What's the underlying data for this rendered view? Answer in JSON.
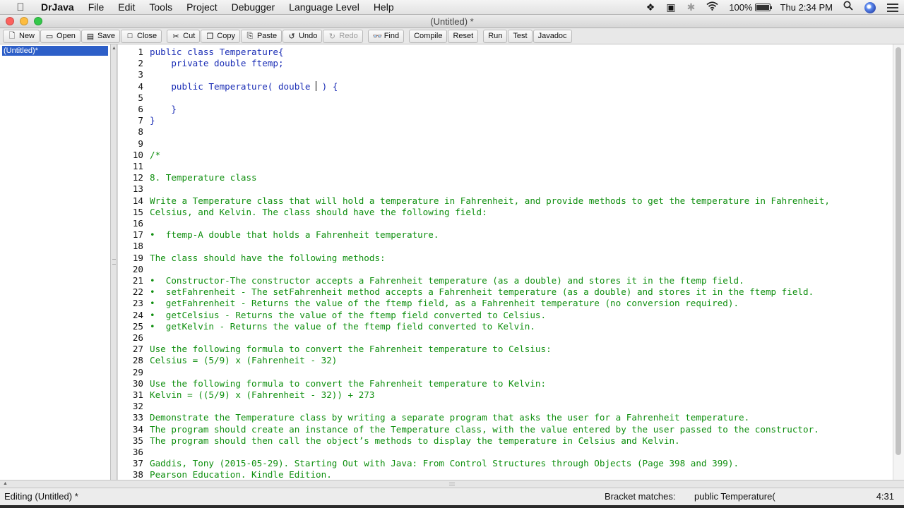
{
  "menubar": {
    "app_name": "DrJava",
    "menus": [
      "File",
      "Edit",
      "Tools",
      "Project",
      "Debugger",
      "Language Level",
      "Help"
    ],
    "battery_text": "100%",
    "clock": "Thu 2:34 PM"
  },
  "window": {
    "title": "(Untitled) *"
  },
  "toolbar": {
    "new": "New",
    "open": "Open",
    "save": "Save",
    "close": "Close",
    "cut": "Cut",
    "copy": "Copy",
    "paste": "Paste",
    "undo": "Undo",
    "redo": "Redo",
    "find": "Find",
    "compile": "Compile",
    "reset": "Reset",
    "run": "Run",
    "test": "Test",
    "javadoc": "Javadoc"
  },
  "documents": {
    "items": [
      "(Untitled)*"
    ]
  },
  "editor": {
    "lines": [
      {
        "n": "1",
        "text": "public class Temperature{",
        "kind": "code"
      },
      {
        "n": "2",
        "text": "    private double ftemp;",
        "kind": "code"
      },
      {
        "n": "3",
        "text": "",
        "kind": "code"
      },
      {
        "n": "4",
        "text": "    public Temperature( double ",
        "kind": "code",
        "caret_after": " ) {"
      },
      {
        "n": "5",
        "text": "",
        "kind": "code"
      },
      {
        "n": "6",
        "text": "    }",
        "kind": "code"
      },
      {
        "n": "7",
        "text": "}",
        "kind": "code"
      },
      {
        "n": "8",
        "text": "",
        "kind": "code"
      },
      {
        "n": "9",
        "text": "",
        "kind": "code"
      },
      {
        "n": "10",
        "text": "/*",
        "kind": "cm"
      },
      {
        "n": "11",
        "text": "",
        "kind": "cm"
      },
      {
        "n": "12",
        "text": "8. Temperature class",
        "kind": "cm"
      },
      {
        "n": "13",
        "text": "",
        "kind": "cm"
      },
      {
        "n": "14",
        "text": "Write a Temperature class that will hold a temperature in Fahrenheit, and provide methods to get the temperature in Fahrenheit,",
        "kind": "cm"
      },
      {
        "n": "15",
        "text": "Celsius, and Kelvin. The class should have the following field:",
        "kind": "cm"
      },
      {
        "n": "16",
        "text": "",
        "kind": "cm"
      },
      {
        "n": "17",
        "text": "•  ftemp-A double that holds a Fahrenheit temperature.",
        "kind": "cm"
      },
      {
        "n": "18",
        "text": "",
        "kind": "cm"
      },
      {
        "n": "19",
        "text": "The class should have the following methods:",
        "kind": "cm"
      },
      {
        "n": "20",
        "text": "",
        "kind": "cm"
      },
      {
        "n": "21",
        "text": "•  Constructor-The constructor accepts a Fahrenheit temperature (as a double) and stores it in the ftemp field.",
        "kind": "cm"
      },
      {
        "n": "22",
        "text": "•  setFahrenheit - The setFahrenheit method accepts a Fahrenheit temperature (as a double) and stores it in the ftemp field.",
        "kind": "cm"
      },
      {
        "n": "23",
        "text": "•  getFahrenheit - Returns the value of the ftemp field, as a Fahrenheit temperature (no conversion required).",
        "kind": "cm"
      },
      {
        "n": "24",
        "text": "•  getCelsius - Returns the value of the ftemp field converted to Celsius.",
        "kind": "cm"
      },
      {
        "n": "25",
        "text": "•  getKelvin - Returns the value of the ftemp field converted to Kelvin.",
        "kind": "cm"
      },
      {
        "n": "26",
        "text": "",
        "kind": "cm"
      },
      {
        "n": "27",
        "text": "Use the following formula to convert the Fahrenheit temperature to Celsius:",
        "kind": "cm"
      },
      {
        "n": "28",
        "text": "Celsius = (5/9) x (Fahrenheit - 32)",
        "kind": "cm"
      },
      {
        "n": "29",
        "text": "",
        "kind": "cm"
      },
      {
        "n": "30",
        "text": "Use the following formula to convert the Fahrenheit temperature to Kelvin:",
        "kind": "cm"
      },
      {
        "n": "31",
        "text": "Kelvin = ((5/9) x (Fahrenheit - 32)) + 273",
        "kind": "cm"
      },
      {
        "n": "32",
        "text": "",
        "kind": "cm"
      },
      {
        "n": "33",
        "text": "Demonstrate the Temperature class by writing a separate program that asks the user for a Fahrenheit temperature.",
        "kind": "cm"
      },
      {
        "n": "34",
        "text": "The program should create an instance of the Temperature class, with the value entered by the user passed to the constructor.",
        "kind": "cm"
      },
      {
        "n": "35",
        "text": "The program should then call the object’s methods to display the temperature in Celsius and Kelvin.",
        "kind": "cm"
      },
      {
        "n": "36",
        "text": "",
        "kind": "cm"
      },
      {
        "n": "37",
        "text": "Gaddis, Tony (2015-05-29). Starting Out with Java: From Control Structures through Objects (Page 398 and 399).",
        "kind": "cm"
      },
      {
        "n": "38",
        "text": "Pearson Education. Kindle Edition.",
        "kind": "cm"
      }
    ]
  },
  "status": {
    "editing": "Editing (Untitled) *",
    "bracket_label": "Bracket matches:",
    "bracket_value": "public Temperature(",
    "position": "4:31"
  }
}
